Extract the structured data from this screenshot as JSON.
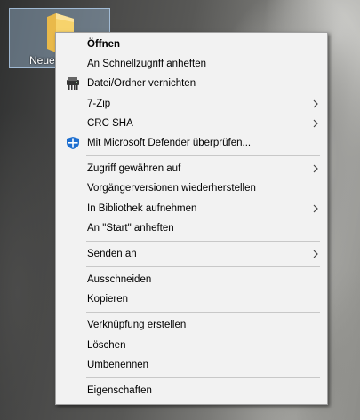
{
  "desktop": {
    "icon_label": "Neuer Ordner"
  },
  "menu": {
    "groups": [
      [
        {
          "label": "Öffnen",
          "bold": true
        },
        {
          "label": "An Schnellzugriff anheften"
        },
        {
          "label": "Datei/Ordner vernichten",
          "icon": "shredder-icon"
        },
        {
          "label": "7-Zip",
          "submenu": true
        },
        {
          "label": "CRC SHA",
          "submenu": true
        },
        {
          "label": "Mit Microsoft Defender überprüfen...",
          "icon": "defender-shield-icon"
        }
      ],
      [
        {
          "label": "Zugriff gewähren auf",
          "submenu": true
        },
        {
          "label": "Vorgängerversionen wiederherstellen"
        },
        {
          "label": "In Bibliothek aufnehmen",
          "submenu": true
        },
        {
          "label": "An \"Start\" anheften"
        }
      ],
      [
        {
          "label": "Senden an",
          "submenu": true
        }
      ],
      [
        {
          "label": "Ausschneiden"
        },
        {
          "label": "Kopieren"
        }
      ],
      [
        {
          "label": "Verknüpfung erstellen"
        },
        {
          "label": "Löschen"
        },
        {
          "label": "Umbenennen"
        }
      ],
      [
        {
          "label": "Eigenschaften"
        }
      ]
    ]
  }
}
